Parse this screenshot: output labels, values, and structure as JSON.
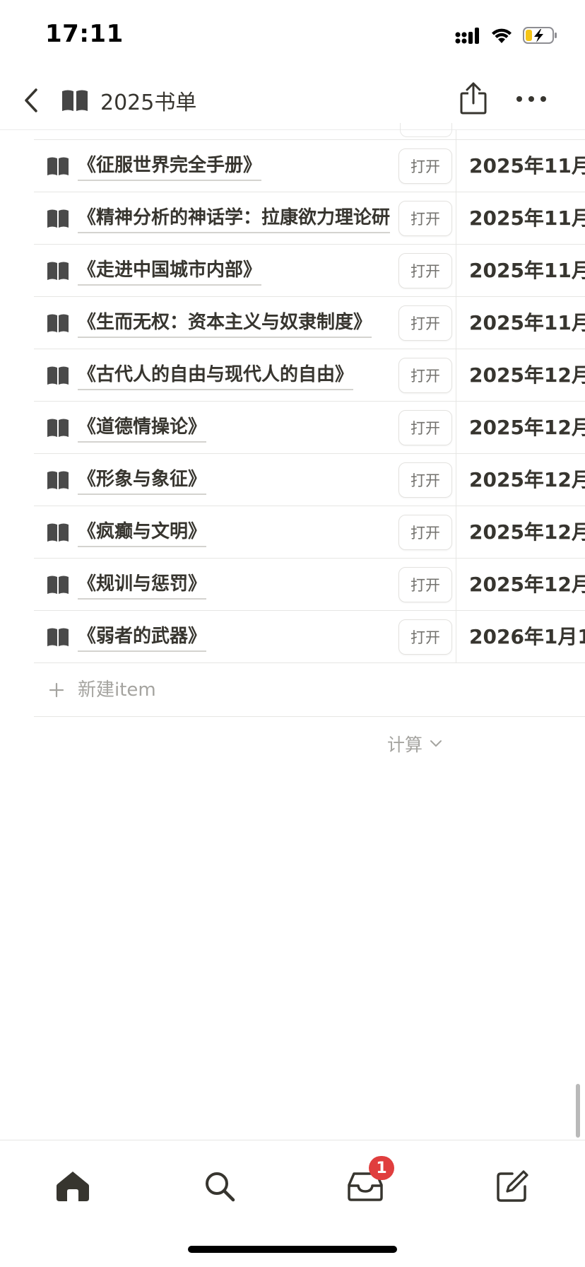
{
  "status_bar": {
    "time": "17:11"
  },
  "header": {
    "title": "2025书单",
    "page_icon": "book-icon"
  },
  "table": {
    "rows": [
      {
        "title": "《征服世界完全手册》",
        "open_label": "打开",
        "date": "2025年11月"
      },
      {
        "title": "《精神分析的神话学：拉康欲力理论研",
        "open_label": "打开",
        "date": "2025年11月"
      },
      {
        "title": "《走进中国城市内部》",
        "open_label": "打开",
        "date": "2025年11月"
      },
      {
        "title": "《生而无权：资本主义与奴隶制度》",
        "open_label": "打开",
        "date": "2025年11月"
      },
      {
        "title": "《古代人的自由与现代人的自由》",
        "open_label": "打开",
        "date": "2025年12月"
      },
      {
        "title": "《道德情操论》",
        "open_label": "打开",
        "date": "2025年12月"
      },
      {
        "title": "《形象与象征》",
        "open_label": "打开",
        "date": "2025年12月"
      },
      {
        "title": "《疯癫与文明》",
        "open_label": "打开",
        "date": "2025年12月"
      },
      {
        "title": "《规训与惩罚》",
        "open_label": "打开",
        "date": "2025年12月"
      },
      {
        "title": "《弱者的武器》",
        "open_label": "打开",
        "date": "2026年1月1"
      }
    ],
    "new_item_label": "新建item",
    "calc_label": "计算"
  },
  "tab_bar": {
    "tabs": [
      "home-icon",
      "search-icon",
      "inbox-icon",
      "compose-icon"
    ],
    "inbox_badge": "1"
  },
  "colors": {
    "text": "#37352f",
    "muted": "#a5a4a0",
    "badge": "#e03e3e",
    "border": "#e6e6e4"
  }
}
